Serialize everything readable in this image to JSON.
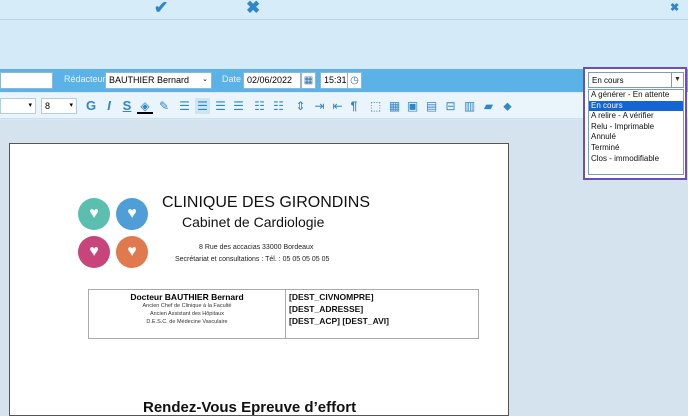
{
  "topbar": {
    "confirm_icon": "check-icon",
    "cancel_icon": "x-icon",
    "close_icon": "x-icon",
    "confirm_glyph": "✔",
    "cancel_glyph": "✖",
    "close_glyph": "✖"
  },
  "form": {
    "redacteur_label": "Rédacteur",
    "redacteur_value": "BAUTHIER Bernard",
    "date_label": "Date",
    "date_value": "02/06/2022",
    "time_value": "15:31"
  },
  "toolbar": {
    "font_size_1": "",
    "font_size_2": "8",
    "bold": "G",
    "italic": "I",
    "underline": "S",
    "paragraph": "¶"
  },
  "document": {
    "clinic_name": "CLINIQUE DES GIRONDINS",
    "clinic_sub": "Cabinet de Cardiologie",
    "address": "8 Rue des accacias 33000 Bordeaux",
    "phone": "Secrétariat et consultations : Tél. : 05 05 05 05 05",
    "doctor": "Docteur  BAUTHIER Bernard",
    "doctor_lines": [
      "Ancien Chef de Clinique à la Faculté",
      "Ancien Assistant des Hôpitaux",
      "D.E.S.C. de Médecine Vasculaire"
    ],
    "dest": [
      "[DEST_CIVNOMPRE]",
      "[DEST_ADRESSE]",
      "[DEST_ACP] [DEST_AVI]"
    ],
    "heading": "Rendez-Vous Epreuve d’effort"
  },
  "status": {
    "selected": "En cours",
    "options": [
      "A générer - En attente",
      "En cours",
      "A relire - A vérifier",
      "Relu - Imprimable",
      "Annulé",
      "Terminé",
      "Clos - immodifiable"
    ],
    "highlighted": 1
  },
  "colors": {
    "accent": "#2f86c8",
    "bar": "#5ab2e6",
    "dropdown_border": "#6a4fb5",
    "selection": "#1464d4"
  }
}
